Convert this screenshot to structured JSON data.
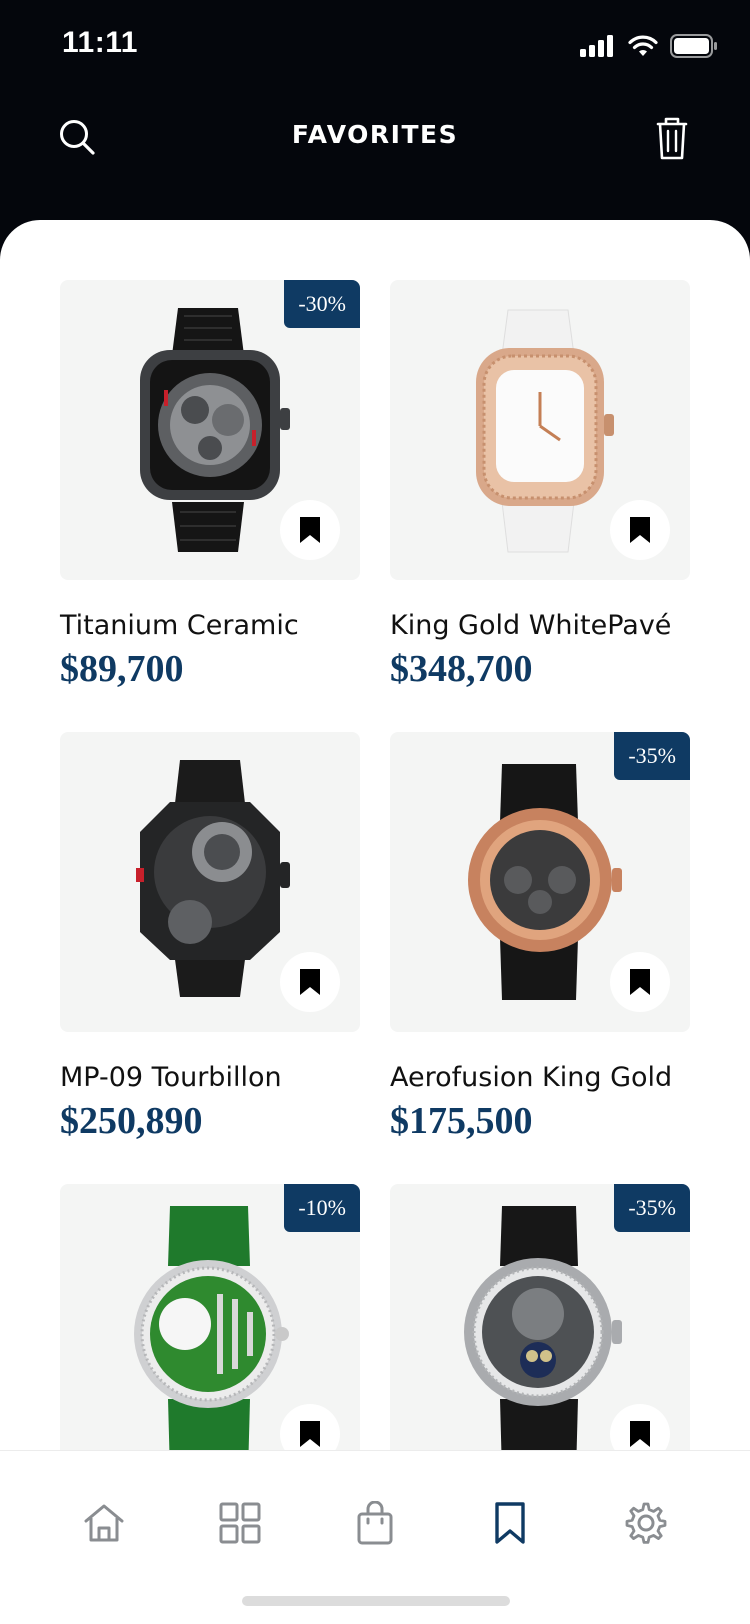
{
  "status_bar": {
    "time": "11:11"
  },
  "header": {
    "title": "FAVORITES",
    "search_icon": "search-icon",
    "trash_icon": "trash-icon"
  },
  "products": [
    {
      "name": "Titanium Ceramic",
      "price": "$89,700",
      "discount": "-30%"
    },
    {
      "name": "King Gold WhitePavé",
      "price": "$348,700",
      "discount": ""
    },
    {
      "name": "MP-09 Tourbillon",
      "price": "$250,890",
      "discount": ""
    },
    {
      "name": "Aerofusion King Gold",
      "price": "$175,500",
      "discount": "-35%"
    },
    {
      "name": "",
      "price": "",
      "discount": "-10%"
    },
    {
      "name": "",
      "price": "",
      "discount": "-35%"
    }
  ],
  "tab_bar": {
    "items": [
      "home-icon",
      "grid-icon",
      "bag-icon",
      "bookmark-icon",
      "gear-icon"
    ],
    "active_index": 3,
    "active_color": "#0f3a63",
    "inactive_color": "#8a8d91"
  },
  "colors": {
    "accent": "#0f3a63",
    "header_bg": "#04060c",
    "card_bg": "#f4f5f4"
  }
}
